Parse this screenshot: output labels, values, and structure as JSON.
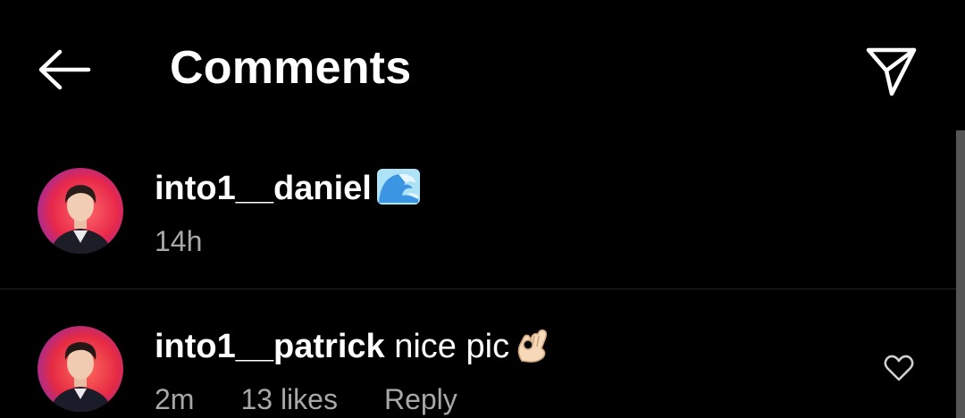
{
  "header": {
    "back_icon": "arrow-left-icon",
    "title": "Comments",
    "share_icon": "paper-plane-icon"
  },
  "caption": {
    "username": "into1__daniel",
    "emoji_icon": "water-wave-emoji-icon",
    "time": "14h"
  },
  "comments": [
    {
      "username": "into1__patrick",
      "text": "nice pic",
      "emoji_icon": "ok-hand-emoji-icon",
      "time": "2m",
      "likes": "13 likes",
      "reply": "Reply",
      "like_icon": "heart-outline-icon"
    }
  ],
  "colors": {
    "background": "#000000",
    "text": "#ffffff",
    "secondary_text": "#a8a8a8",
    "divider": "#262626"
  }
}
